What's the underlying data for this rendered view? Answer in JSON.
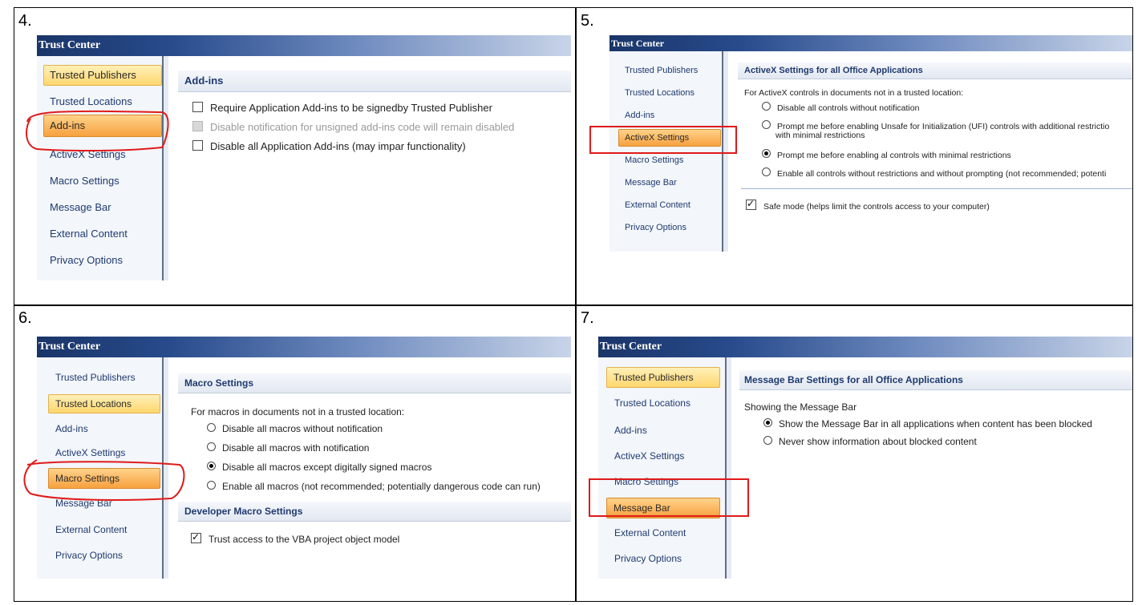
{
  "steps": [
    "4.",
    "5.",
    "6.",
    "7."
  ],
  "window_title": "Trust Center",
  "nav_items": [
    "Trusted Publishers",
    "Trusted Locations",
    "Add-ins",
    "ActiveX Settings",
    "Macro Settings",
    "Message Bar",
    "External Content",
    "Privacy Options"
  ],
  "panel4": {
    "heading": "Add-ins",
    "options": [
      {
        "label": "Require Application Add-ins to be signedby Trusted Publisher",
        "checked": false,
        "disabled": false
      },
      {
        "label": "Disable notification for unsigned add-ins code will remain disabled",
        "checked": false,
        "disabled": true
      },
      {
        "label": "Disable all Application Add-ins (may impar functionality)",
        "checked": false,
        "disabled": false
      }
    ]
  },
  "panel5": {
    "heading": "ActiveX Settings for all Office Applications",
    "intro": "For ActiveX controls in documents not in a trusted location:",
    "radios": [
      "Disable all controls without notification",
      "Prompt me before enabling Unsafe for Initialization (UFI) controls with additional restrictio",
      "Prompt me before enabling al controls with minimal restrictions",
      "Enable all controls without restrictions and without prompting (not recommended; potenti"
    ],
    "radio_line2": "with minimal restrictions",
    "selected_radio": 2,
    "safe_mode": "Safe mode (helps limit the controls access to your computer)"
  },
  "panel6": {
    "heading": "Macro Settings",
    "intro": "For macros in documents not in a trusted location:",
    "radios": [
      "Disable all macros without notification",
      "Disable all macros with notification",
      "Disable all macros except digitally signed macros",
      "Enable all macros (not recommended; potentially dangerous code can run)"
    ],
    "selected_radio": 2,
    "dev_heading": "Developer Macro Settings",
    "vba": "Trust access to the VBA project object model"
  },
  "panel7": {
    "heading": "Message Bar Settings for all Office Applications",
    "intro": "Showing the Message Bar",
    "radios": [
      "Show the Message Bar in all applications when content has been blocked",
      "Never show information about blocked content"
    ],
    "selected_radio": 0
  },
  "colors": {
    "title_bar": "#284b8c",
    "selected_nav": "#f7a13e",
    "highlight": "#e01a1a"
  }
}
